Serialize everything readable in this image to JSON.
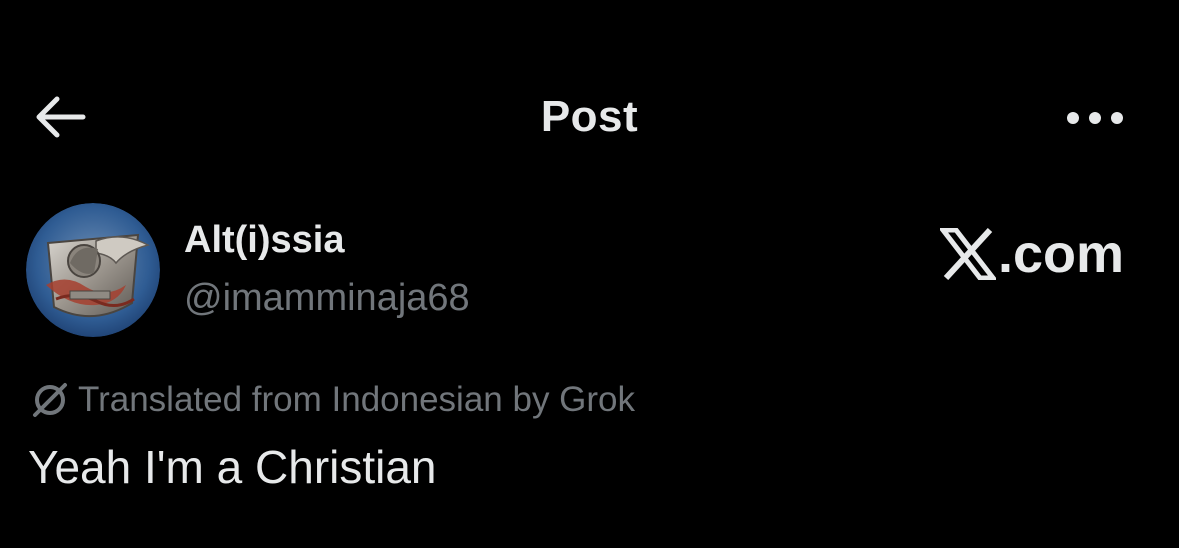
{
  "header": {
    "title": "Post",
    "back_icon": "arrow-left-icon",
    "more_icon": "more-horizontal-icon"
  },
  "author": {
    "display_name": "Alt(i)ssia",
    "handle": "@imamminaja68",
    "avatar_icon": "avatar-image"
  },
  "watermark": {
    "logo_icon": "x-logo-icon",
    "text": ".com"
  },
  "translation": {
    "icon": "translate-icon",
    "label": "Translated from Indonesian by Grok"
  },
  "post": {
    "text": "Yeah I'm a Christian"
  },
  "colors": {
    "background": "#000000",
    "primary_text": "#e7e9ea",
    "secondary_text": "#71767b"
  }
}
